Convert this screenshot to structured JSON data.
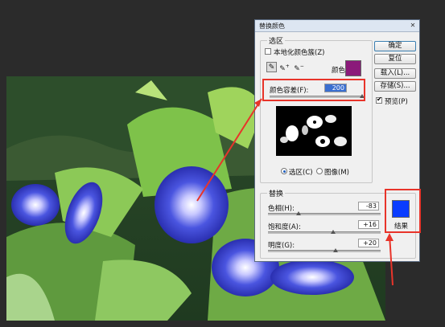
{
  "dialog": {
    "title": "替换颜色",
    "selection": {
      "group_label": "选区",
      "localized_label": "本地化颜色簇(Z)",
      "localized_checked": false,
      "color_label": "颜色:",
      "color_swatch": "#8b1a7a",
      "fuzziness_label": "颜色容差(F):",
      "fuzziness_value": "200",
      "fuzziness_level": 1.0,
      "tools": [
        "eyedropper-icon",
        "eyedropper-plus-icon",
        "eyedropper-minus-icon"
      ],
      "radio_selection": "选区(C)",
      "radio_image": "图像(M)",
      "selected_view": "selection"
    },
    "replacement": {
      "group_label": "替换",
      "hue_label": "色相(H):",
      "hue_value": "-83",
      "hue_level": 0.27,
      "saturation_label": "饱和度(A):",
      "saturation_value": "+16",
      "saturation_level": 0.58,
      "lightness_label": "明度(G):",
      "lightness_value": "+20",
      "lightness_level": 0.6,
      "result_label": "结果",
      "result_color": "#0a3cff"
    },
    "buttons": {
      "ok": "确定",
      "reset": "复位",
      "load": "载入(L)...",
      "save": "存储(S)...",
      "preview_label": "预览(P)",
      "preview_checked": true
    }
  },
  "colors": {
    "annotation_red": "#e8342a",
    "background": "#2b2b2b"
  }
}
